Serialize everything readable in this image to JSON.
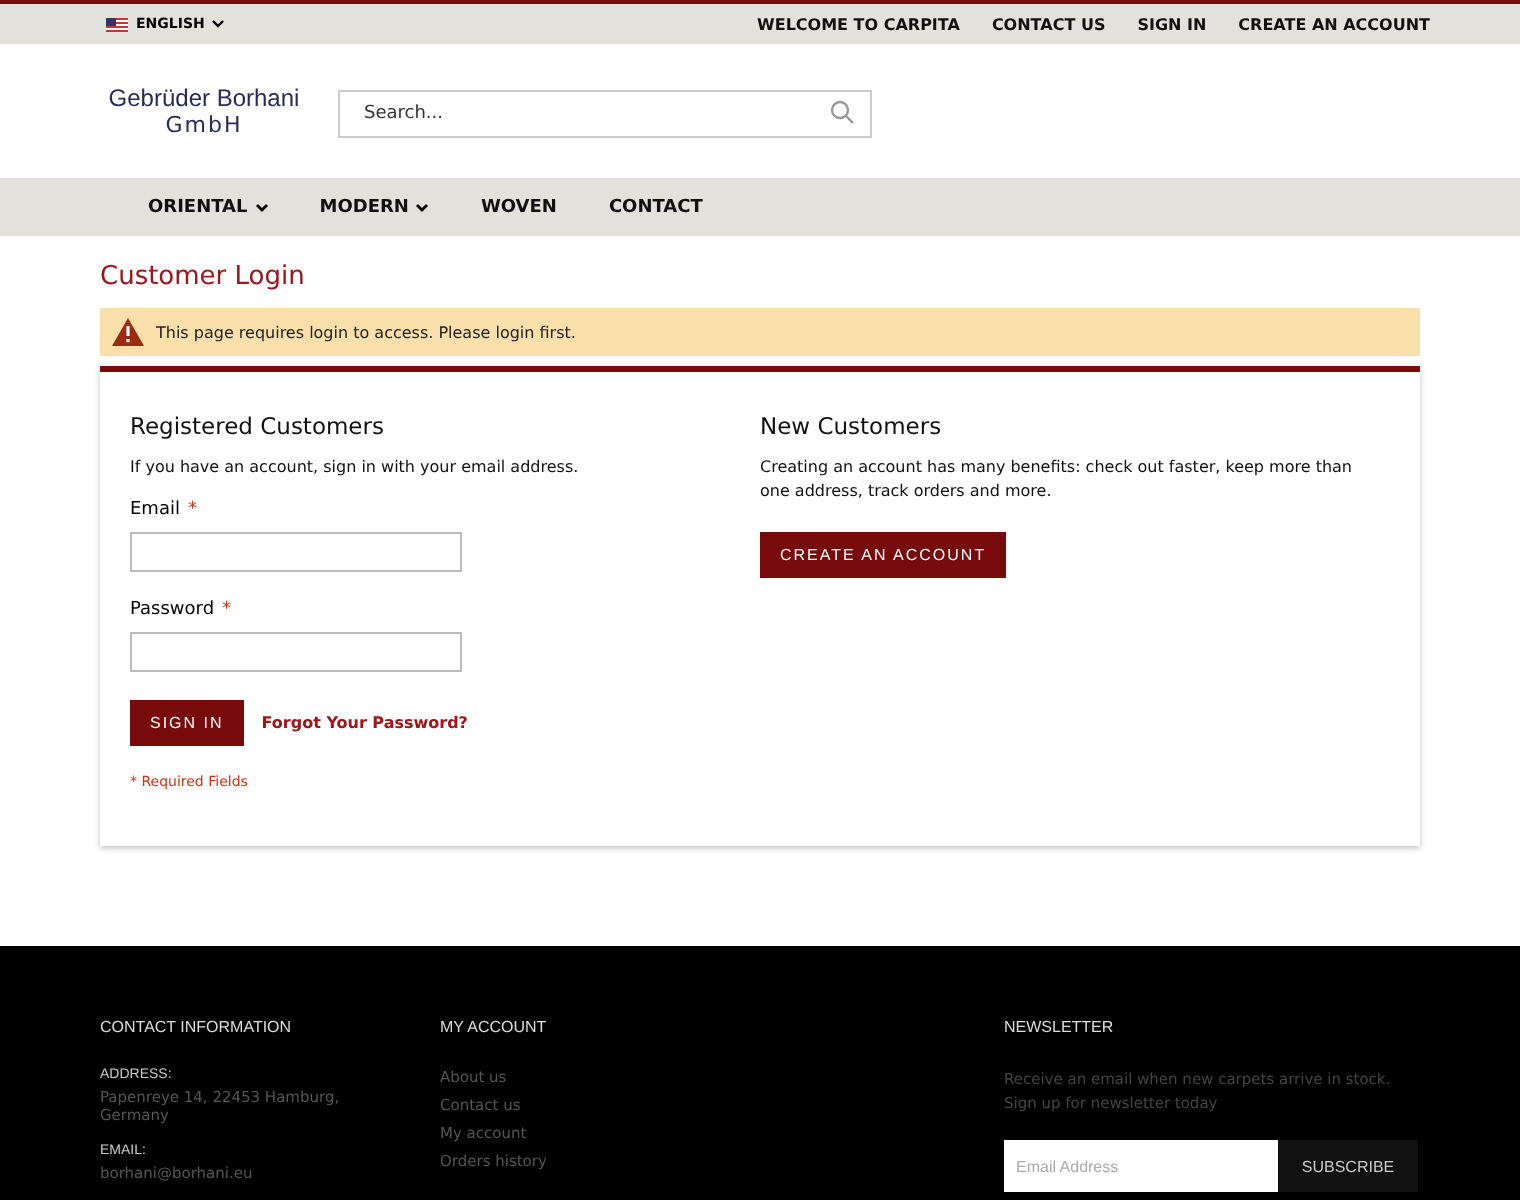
{
  "top_bar": {
    "language": "ENGLISH",
    "links": [
      "WELCOME TO CARPITA",
      "CONTACT US",
      "SIGN IN",
      "CREATE AN ACCOUNT"
    ]
  },
  "header": {
    "logo_line1": "Gebrüder Borhani",
    "logo_line2": "GmbH",
    "search": {
      "placeholder": "Search..."
    }
  },
  "nav": [
    {
      "label": "ORIENTAL",
      "has_menu": true
    },
    {
      "label": "MODERN",
      "has_menu": true
    },
    {
      "label": "WOVEN",
      "has_menu": false
    },
    {
      "label": "CONTACT",
      "has_menu": false
    }
  ],
  "page_title": "Customer Login",
  "notice": "This page requires login to access. Please login first.",
  "registered": {
    "title": "Registered Customers",
    "intro": "If you have an account, sign in with your email address.",
    "fields": [
      {
        "label": "Email",
        "required_mark": "*"
      },
      {
        "label": "Password",
        "required_mark": "*"
      }
    ],
    "sign_in": "SIGN IN",
    "forgot": "Forgot Your Password?",
    "required_note": "* Required Fields"
  },
  "new_customers": {
    "title": "New Customers",
    "text": "Creating an account has many benefits: check out faster, keep more than one address, track orders and more.",
    "button": "CREATE AN ACCOUNT"
  },
  "footer": {
    "contact": {
      "title": "CONTACT INFORMATION",
      "address_label": "ADDRESS:",
      "address": "Papenreye 14, 22453 Hamburg, Germany",
      "email_label": "EMAIL:",
      "email": "borhani@borhani.eu"
    },
    "account": {
      "title": "MY ACCOUNT",
      "links": [
        "About us",
        "Contact us",
        "My account",
        "Orders history"
      ]
    },
    "newsletter": {
      "title": "NEWSLETTER",
      "text": "Receive an email when new carpets arrive in stock. Sign up for newsletter today",
      "placeholder": "Email Address",
      "button": "SUBSCRIBE"
    }
  }
}
